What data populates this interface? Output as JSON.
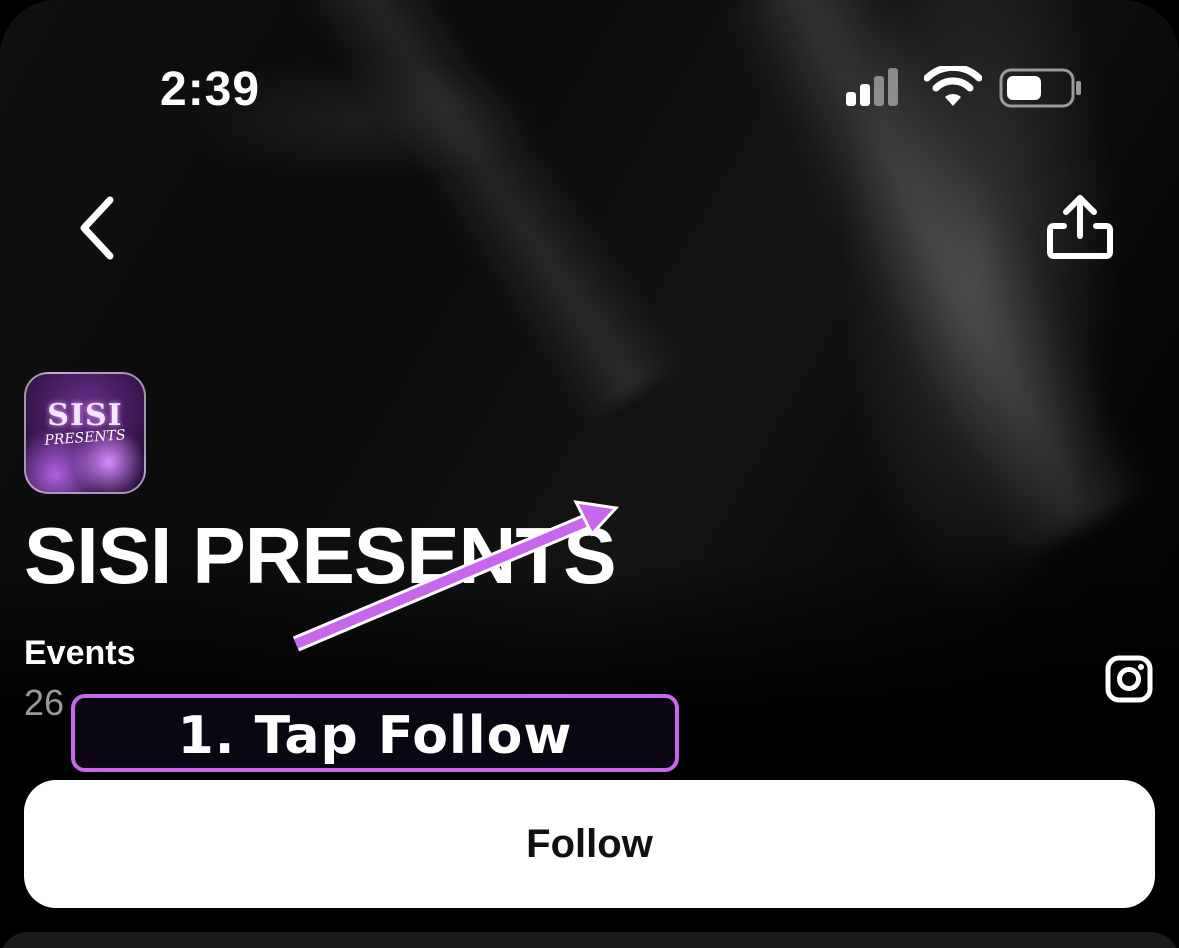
{
  "status_bar": {
    "time": "2:39",
    "icons": [
      "cellular-signal-icon",
      "wifi-icon",
      "battery-icon"
    ]
  },
  "nav": {
    "back_icon": "chevron-left-icon",
    "share_icon": "share-icon"
  },
  "profile": {
    "avatar_text": "SISI",
    "avatar_subtext": "PRESENTS",
    "name": "SISI PRESENTS",
    "events_label": "Events",
    "events_count": "26",
    "social_icon": "instagram-icon"
  },
  "annotation": {
    "text": "1. Tap Follow",
    "color": "#c966ee"
  },
  "actions": {
    "follow_label": "Follow"
  }
}
